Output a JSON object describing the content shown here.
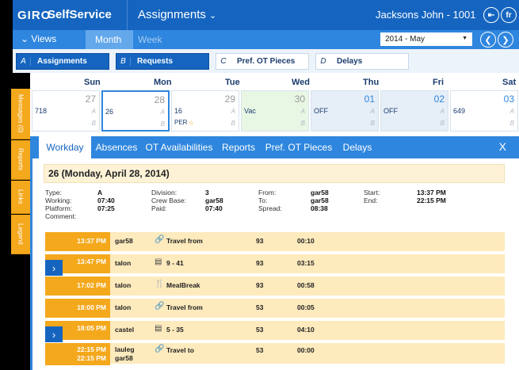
{
  "side_tabs": [
    {
      "label": "Messages (0)"
    },
    {
      "label": "Reports"
    },
    {
      "label": "Links"
    },
    {
      "label": "Legend"
    }
  ],
  "topbar": {
    "logo": "GIRO",
    "app": "SelfService",
    "title": "Assignments",
    "title_icon": "chevron-down-icon",
    "user": "Jacksons John - 1001",
    "logout_icon": "logout-icon",
    "lang": "fr"
  },
  "views_bar": {
    "views_label": "Views",
    "month": "Month",
    "week": "Week",
    "period": "2014 - May"
  },
  "filters": [
    {
      "key": "A",
      "label": "Assignments"
    },
    {
      "key": "B",
      "label": "Requests"
    },
    {
      "key": "C",
      "label": "Pref. OT Pieces"
    },
    {
      "key": "D",
      "label": "Delays"
    }
  ],
  "day_headers": [
    "Sun",
    "Mon",
    "Tue",
    "Wed",
    "Thu",
    "Fri",
    "Sat"
  ],
  "calendar": [
    {
      "day": "27",
      "code": "718",
      "a": "A",
      "b": "B",
      "extra": ""
    },
    {
      "day": "28",
      "code": "26",
      "a": "A",
      "b": "B",
      "extra": ""
    },
    {
      "day": "29",
      "code": "16",
      "a": "A",
      "b": "B",
      "extra": "PER"
    },
    {
      "day": "30",
      "code": "Vac",
      "a": "A",
      "b": "B",
      "extra": ""
    },
    {
      "day": "01",
      "code": "OFF",
      "a": "A",
      "b": "B",
      "extra": ""
    },
    {
      "day": "02",
      "code": "OFF",
      "a": "A",
      "b": "B",
      "extra": ""
    },
    {
      "day": "03",
      "code": "649",
      "a": "A",
      "b": "B",
      "extra": ""
    }
  ],
  "panel": {
    "tabs": [
      "Workday",
      "Absences",
      "OT Availabilities",
      "Reports",
      "Pref. OT Pieces",
      "Delays"
    ],
    "close": "X",
    "heading": "26 (Monday, April 28, 2014)",
    "info": {
      "type_label": "Type:",
      "type": "A",
      "working_label": "Working:",
      "working": "07:40",
      "platform_label": "Platform:",
      "platform": "07:25",
      "comment_label": "Comment:",
      "division_label": "Division:",
      "division": "3",
      "crewbase_label": "Crew Base:",
      "crewbase": "gar58",
      "paid_label": "Paid:",
      "paid": "07:40",
      "from_label": "From:",
      "from": "gar58",
      "to_label": "To:",
      "to": "gar58",
      "spread_label": "Spread:",
      "spread": "08:38",
      "start_label": "Start:",
      "start": "13:37 PM",
      "end_label": "End:",
      "end": "22:15 PM"
    },
    "rows": [
      {
        "time": "13:37 PM",
        "location": "gar58",
        "icon": "link-icon",
        "desc": "Travel from",
        "num": "93",
        "dur": "00:10",
        "expand": false
      },
      {
        "time": "13:47 PM",
        "location": "talon",
        "icon": "bus-icon",
        "desc": "9 - 41",
        "num": "93",
        "dur": "03:15",
        "expand": true
      },
      {
        "time": "17:02 PM",
        "location": "talon",
        "icon": "fork-knife-icon",
        "desc": "MealBreak",
        "num": "93",
        "dur": "00:58",
        "expand": false
      },
      {
        "time": "18:00 PM",
        "location": "talon",
        "icon": "link-icon",
        "desc": "Travel from",
        "num": "53",
        "dur": "00:05",
        "expand": false
      },
      {
        "time": "18:05 PM",
        "location": "castel",
        "icon": "bus-icon",
        "desc": "5 - 35",
        "num": "53",
        "dur": "04:10",
        "expand": true
      },
      {
        "time": "22:15 PM",
        "time2": "22:15 PM",
        "location": "lauleg",
        "location2": "gar58",
        "icon": "link-icon",
        "desc": "Travel to",
        "num": "53",
        "dur": "00:00",
        "expand": false
      }
    ]
  },
  "colors": {
    "primary": "#1565c0",
    "accent": "#2e86de",
    "orange": "#f4a81c",
    "row_bg": "#fdeabd"
  }
}
